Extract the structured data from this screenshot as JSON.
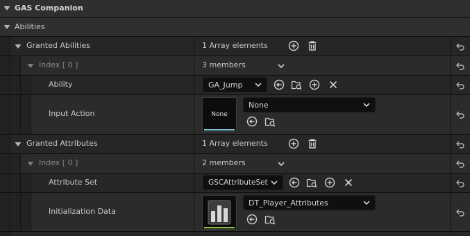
{
  "header": {
    "title": "GAS Companion"
  },
  "abilities_category": {
    "label": "Abilities"
  },
  "granted_abilities": {
    "label": "Granted Abilities",
    "count": "1 Array elements",
    "index": {
      "label": "Index [ 0 ]",
      "members": "3 members",
      "ability": {
        "label": "Ability",
        "value": "GA_Jump"
      },
      "input_action": {
        "label": "Input Action",
        "thumbnail_text": "None",
        "value": "None"
      }
    }
  },
  "granted_attributes": {
    "label": "Granted Attributes",
    "count": "1 Array elements",
    "index": {
      "label": "Index [ 0 ]",
      "members": "2 members",
      "attribute_set": {
        "label": "Attribute Set",
        "value": "GSCAttributeSet"
      },
      "initialization_data": {
        "label": "Initialization Data",
        "value": "DT_Player_Attributes"
      }
    }
  },
  "colors": {
    "background": "#262626",
    "category": "#2f2f2f",
    "field": "#0f0f0f",
    "input_action_accent": "#7cc6d6",
    "data_table_accent": "#8bc34a"
  }
}
